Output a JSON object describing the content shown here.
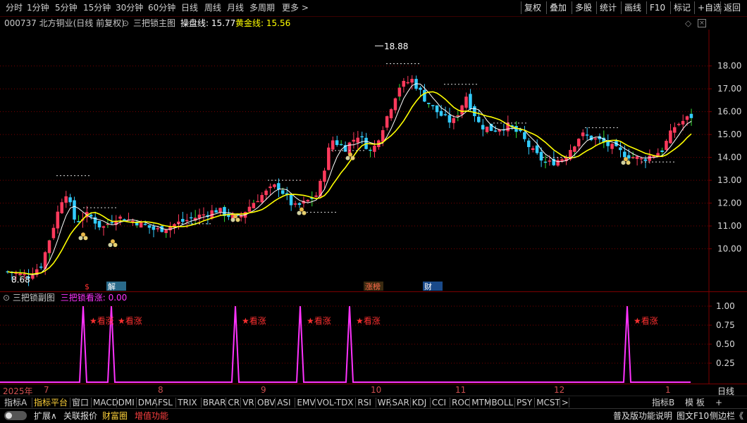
{
  "toolbar": {
    "periods": [
      "分时",
      "1分钟",
      "5分钟",
      "15分钟",
      "30分钟",
      "60分钟",
      "日线",
      "周线",
      "月线",
      "多周期",
      "更多 >"
    ],
    "right_buttons": [
      "复权",
      "叠加",
      "多股",
      "统计",
      "画线",
      "F10",
      "标记",
      "+自选",
      "返回"
    ]
  },
  "info": {
    "stock": "000737 北方铜业(日线 前复权)",
    "indicator_name": "三把锁主图",
    "cao_label": "操盘线: 15.77",
    "gold_label": "黄金线: 15.56"
  },
  "sub": {
    "title": "三把锁副图",
    "signal_label": "三把锁看涨: 0.00",
    "axis_labels": [
      "1.00",
      "0.75",
      "0.50",
      "0.25"
    ],
    "signal_texts": [
      "★看涨",
      "★看涨",
      "★看涨",
      "★看涨",
      "★看涨",
      "★看涨"
    ]
  },
  "markers": {
    "m1": "$",
    "m2": "解",
    "m3": "涨榜",
    "m4": "财"
  },
  "annotations": {
    "high": "18.88",
    "low": "8.68"
  },
  "chart_data": {
    "type": "candlestick",
    "price_axis": [
      "18.00",
      "17.00",
      "16.00",
      "15.00",
      "14.00",
      "13.00",
      "12.00",
      "11.00",
      "10.00"
    ],
    "ylim": [
      8.2,
      19.5
    ],
    "date_labels": [
      "2025年",
      "7",
      "8",
      "9",
      "10",
      "11",
      "12",
      "1"
    ],
    "annotations": [
      "18.88",
      "8.68"
    ],
    "last_close": 15.95,
    "cao_line": 15.77,
    "gold_line": 15.56
  },
  "tabs": [
    "指标A",
    "指标平台",
    "窗口",
    "MACD",
    "DMI",
    "DMA",
    "FSL",
    "TRIX",
    "BRAR",
    "CR",
    "VR",
    "OBV",
    "ASI",
    "EMV",
    "VOL-TDX",
    "RSI",
    "WR",
    "SAR",
    "KDJ",
    "CCI",
    "ROC",
    "MTM",
    "BOLL",
    "PSY",
    "MCST",
    ">"
  ],
  "tabs_right": [
    "指标B",
    "模 板",
    "+"
  ],
  "bottom": {
    "toggle_label": "",
    "expand": "扩展∧",
    "related": "关联报价",
    "wealth": "财富圈",
    "value_added": "增值功能",
    "help": "普及版功能说明",
    "f10": "图文F10",
    "sidebar": "侧边栏《"
  },
  "axis_right": {
    "date_tab": "日线"
  },
  "colors": {
    "up": "#ff3a5c",
    "down": "#33ccff",
    "cao": "#ffffff",
    "gold": "#ffff00",
    "signal": "#ff33ff",
    "grid_red": "#7a0000"
  }
}
